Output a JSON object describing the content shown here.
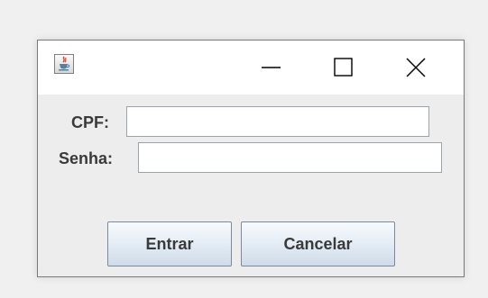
{
  "window": {
    "title": "",
    "icon": "java-coffee-cup-icon",
    "controls": [
      "minimize-icon",
      "maximize-icon",
      "close-icon"
    ]
  },
  "form": {
    "cpf_label": "CPF:",
    "cpf_value": "",
    "senha_label": "Senha:",
    "senha_value": ""
  },
  "buttons": {
    "entrar_label": "Entrar",
    "cancelar_label": "Cancelar"
  },
  "colors": {
    "window_bg": "#ececec",
    "titlebar_bg": "#ffffff",
    "button_gradient_top": "#f7fafd",
    "button_gradient_bottom": "#cfdbe8"
  }
}
